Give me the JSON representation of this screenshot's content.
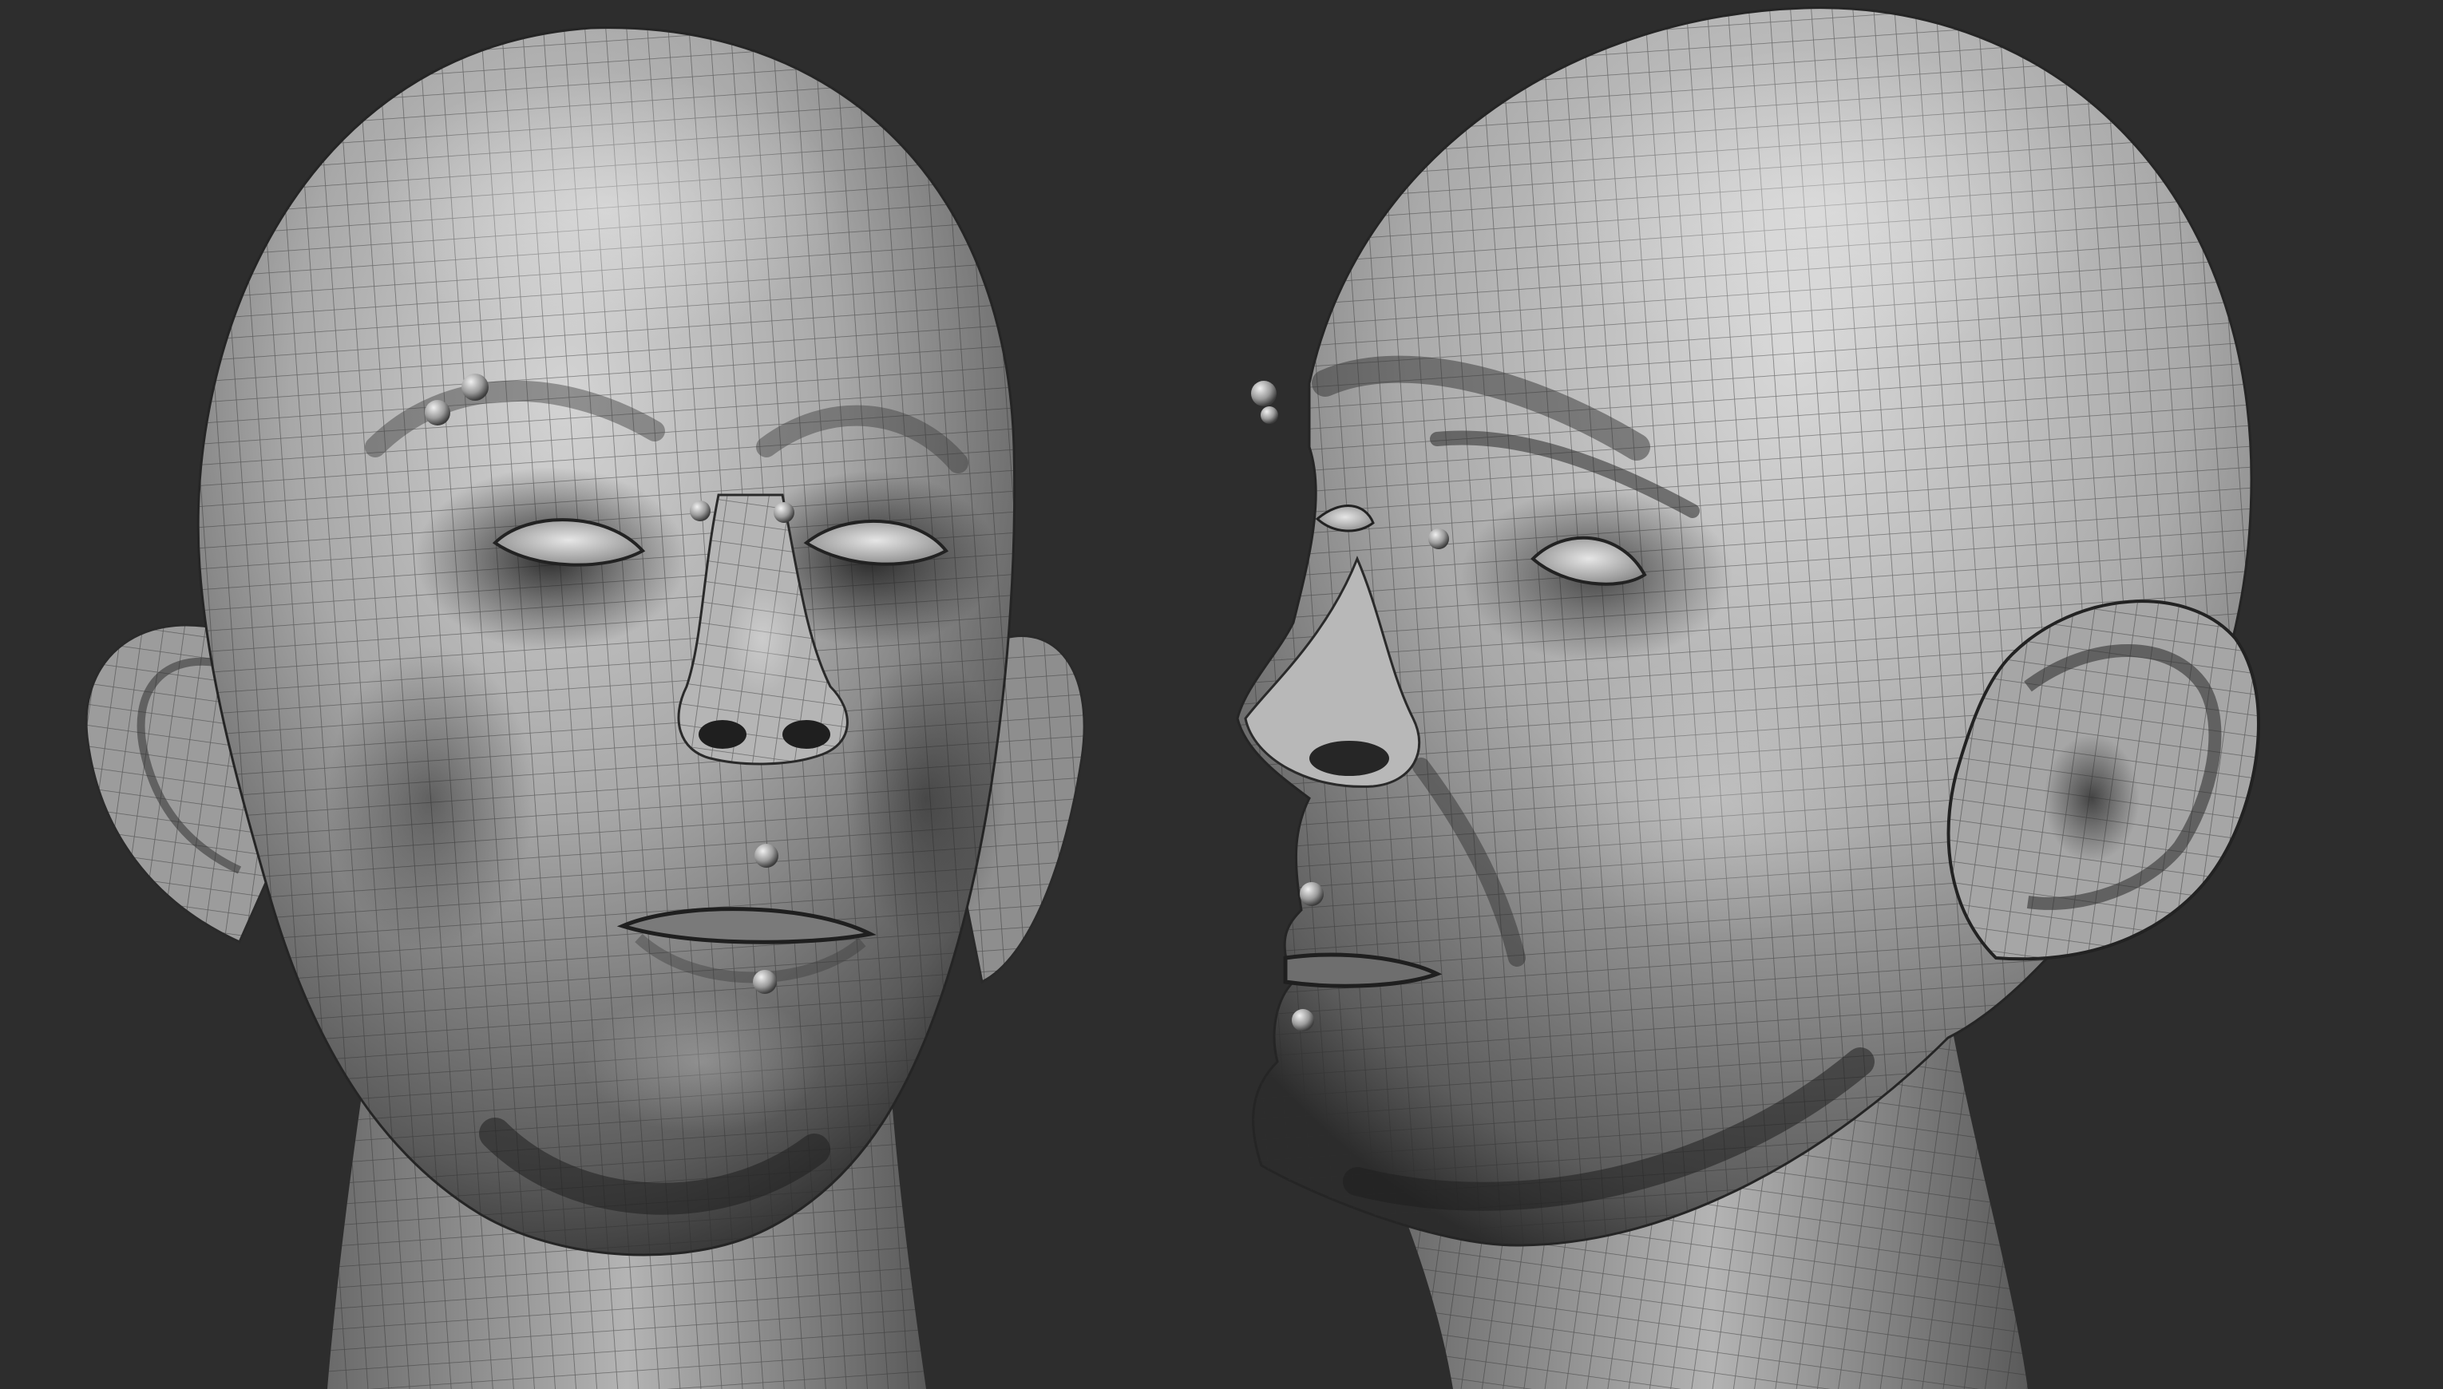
{
  "render": {
    "style": "clay-shaded sculpt with wireframe overlay",
    "colors": {
      "background": "#2d2d2d",
      "clay_light": "#cfcfcf",
      "clay_mid": "#8f8f8f",
      "clay_dark": "#2a2a2a",
      "wire": "#3a3a3a",
      "marker": "#d8d8d8"
    }
  },
  "views": [
    {
      "name": "front-view",
      "marker_count": 6
    },
    {
      "name": "profile-view",
      "marker_count": 5
    }
  ]
}
